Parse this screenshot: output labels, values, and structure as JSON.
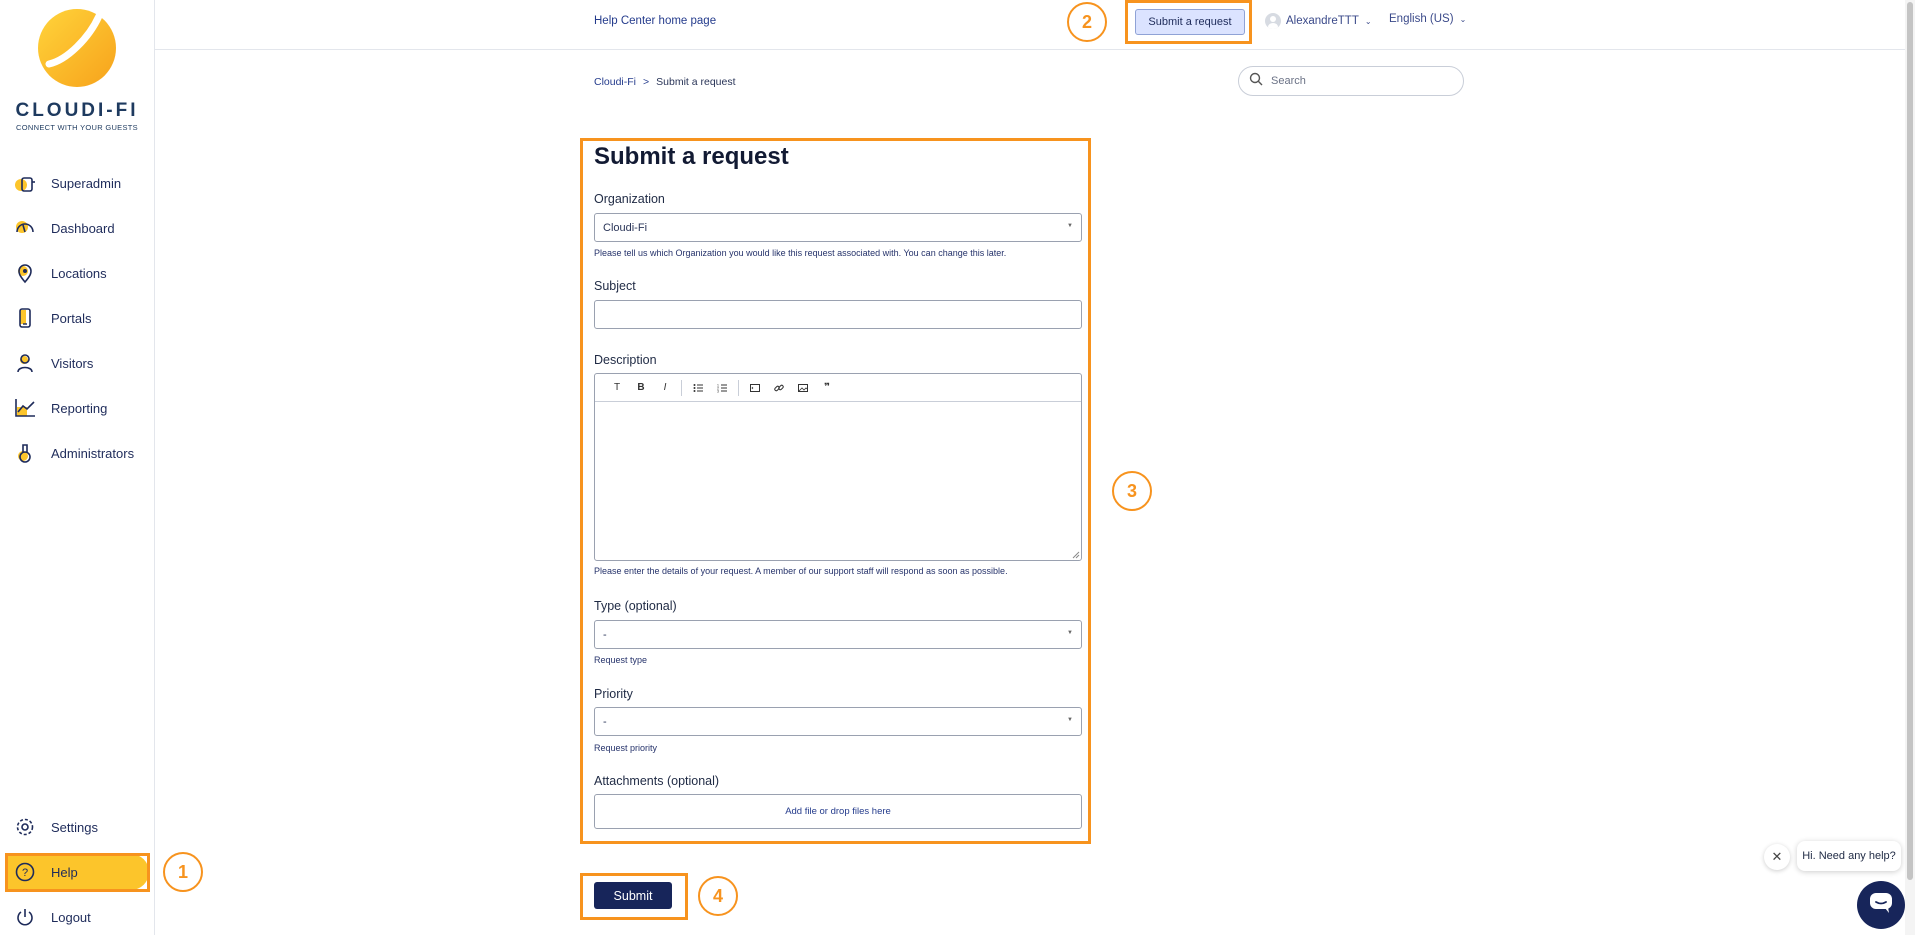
{
  "sidebar": {
    "logo_text": "CLOUDI-FI",
    "logo_tagline": "CONNECT WITH YOUR GUESTS",
    "items": [
      {
        "label": "Superadmin",
        "icon": "superadmin-icon"
      },
      {
        "label": "Dashboard",
        "icon": "dashboard-icon"
      },
      {
        "label": "Locations",
        "icon": "location-pin-icon"
      },
      {
        "label": "Portals",
        "icon": "phone-icon"
      },
      {
        "label": "Visitors",
        "icon": "user-icon"
      },
      {
        "label": "Reporting",
        "icon": "chart-icon"
      },
      {
        "label": "Administrators",
        "icon": "admin-icon"
      }
    ],
    "settings_label": "Settings",
    "help_label": "Help",
    "logout_label": "Logout"
  },
  "header": {
    "help_center_link": "Help Center home page",
    "submit_request_label": "Submit a request",
    "user_name": "AlexandreTTT",
    "language": "English (US)"
  },
  "breadcrumb": {
    "root": "Cloudi-Fi",
    "separator": ">",
    "current": "Submit a request"
  },
  "search": {
    "placeholder": "Search"
  },
  "form": {
    "title": "Submit a request",
    "organization_label": "Organization",
    "organization_value": "Cloudi-Fi",
    "organization_hint": "Please tell us which Organization you would like this request associated with. You can change this later.",
    "subject_label": "Subject",
    "subject_value": "",
    "description_label": "Description",
    "description_hint": "Please enter the details of your request. A member of our support staff will respond as soon as possible.",
    "toolbar": {
      "text": "T",
      "bold": "B",
      "italic": "I",
      "quote": "❞"
    },
    "type_label": "Type (optional)",
    "type_value": "-",
    "type_hint": "Request type",
    "priority_label": "Priority",
    "priority_value": "-",
    "priority_hint": "Request priority",
    "attachments_label": "Attachments (optional)",
    "attachments_action": "Add file or drop files here",
    "submit_label": "Submit"
  },
  "annotations": {
    "step1": "1",
    "step2": "2",
    "step3": "3",
    "step4": "4",
    "highlight_color": "#f7931e"
  },
  "chat": {
    "close_symbol": "✕",
    "bubble_text": "Hi. Need any help?"
  },
  "colors": {
    "brand_yellow": "#fcc52b",
    "navy": "#17255a",
    "link": "#243b8c"
  }
}
